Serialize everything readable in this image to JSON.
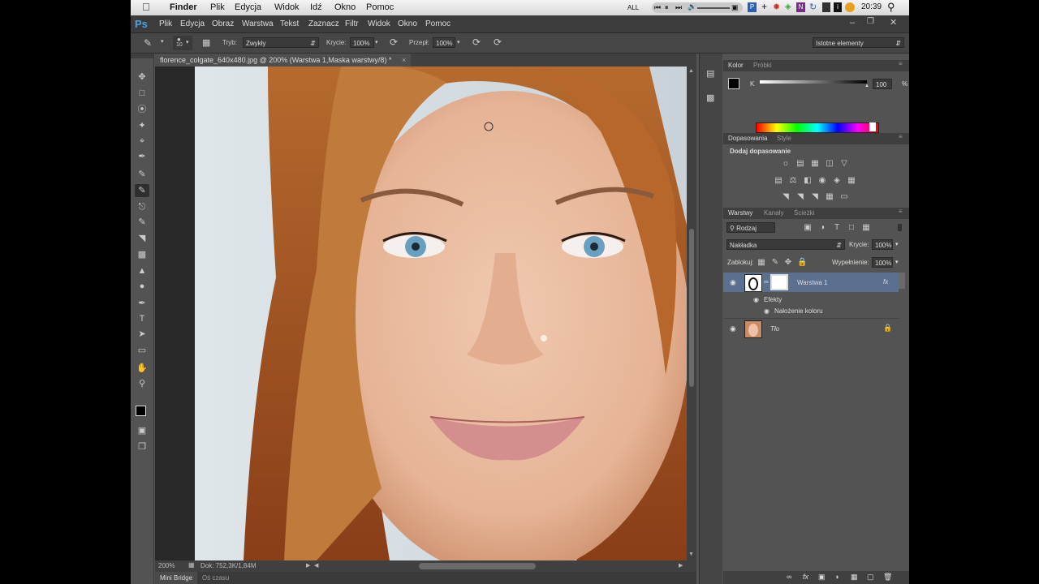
{
  "mac_menu": {
    "apple": "",
    "items": [
      "Finder",
      "Plik",
      "Edycja",
      "Widok",
      "Idź",
      "Okno",
      "Pomoc"
    ],
    "status_all": "ALL",
    "clock": "20:39"
  },
  "ps_menu": {
    "logo": "Ps",
    "items": [
      "Plik",
      "Edycja",
      "Obraz",
      "Warstwa",
      "Tekst",
      "Zaznacz",
      "Filtr",
      "Widok",
      "Okno",
      "Pomoc"
    ]
  },
  "options_bar": {
    "brush_size": "10",
    "mode_label": "Tryb:",
    "mode_value": "Zwykły",
    "opacity_label": "Krycie:",
    "opacity_value": "100%",
    "flow_label": "Przepł:",
    "flow_value": "100%",
    "workspace": "Istotne elementy"
  },
  "document": {
    "tab_title": "florence_colgate_640x480.jpg @ 200% (Warstwa 1,Maska warstwy/8) *",
    "zoom": "200%",
    "doc_info": "Dok: 752,3K/1,84M"
  },
  "bottom_tabs": [
    "Mini Bridge",
    "Oś czasu"
  ],
  "color_panel": {
    "tabs": [
      "Kolor",
      "Próbki"
    ],
    "channel": "K",
    "value": "100",
    "unit": "%"
  },
  "adjustments_panel": {
    "tabs": [
      "Dopasowania",
      "Style"
    ],
    "heading": "Dodaj dopasowanie"
  },
  "layers_panel": {
    "tabs": [
      "Warstwy",
      "Kanały",
      "Ścieżki"
    ],
    "filter_kind": "Rodzaj",
    "blend_mode": "Nakładka",
    "opacity_label": "Krycie:",
    "opacity_value": "100%",
    "lock_label": "Zablokuj:",
    "fill_label": "Wypełnienie:",
    "fill_value": "100%",
    "layers": [
      {
        "name": "Warstwa 1",
        "selected": true,
        "fx": "fx"
      },
      {
        "name": "Efekty"
      },
      {
        "name": "Nałożenie koloru"
      },
      {
        "name": "Tło"
      }
    ]
  },
  "colors": {
    "ps_bg": "#535353",
    "selected_layer": "#5b6f8e"
  }
}
